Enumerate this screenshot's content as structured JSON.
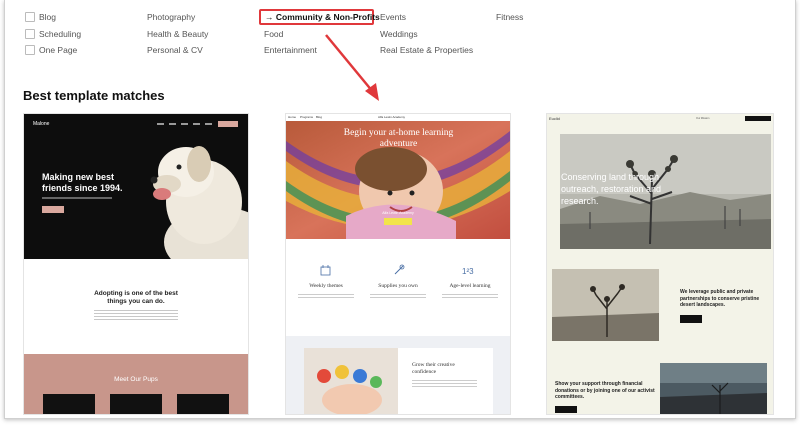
{
  "categories": {
    "col1": [
      "Blog",
      "Scheduling",
      "One Page"
    ],
    "col2": [
      "Photography",
      "Health & Beauty",
      "Personal & CV"
    ],
    "col3_selected": "Community & Non-Profits",
    "col3": [
      "Food",
      "Entertainment"
    ],
    "col4": [
      "Events",
      "Weddings",
      "Real Estate & Properties"
    ],
    "col5": [
      "Fitness"
    ]
  },
  "selected_arrow": "→",
  "section_title": "Best template matches",
  "templates": [
    {
      "brand": "Malone",
      "hero_title": "Making new best friends since 1994.",
      "mid_heading": "Adopting is one of the best things you can do.",
      "bottom_heading": "Meet Our Pups",
      "colors": {
        "hero_bg": "#0d0d0d",
        "button": "#d9a89e",
        "bottom_bg": "#c8968b"
      }
    },
    {
      "brand": "Alfa Lewin Academy",
      "nav": [
        "Home",
        "Programs",
        "Blog"
      ],
      "hero_title": "Begin your at-home learning adventure",
      "hero_sub": "Alfa Lewin Academy",
      "features": [
        "Weekly themes",
        "Supplies you own",
        "Age-level learning"
      ],
      "promo_heading": "Grow their creative confidence",
      "colors": {
        "button": "#f2e44a",
        "promo_bg": "#eef0f4"
      }
    },
    {
      "brand": "Euclid",
      "nav": [
        "Our Mission",
        "Get Involved"
      ],
      "hero_title": "Conserving land through outreach, restoration and research.",
      "mid_text": "We leverage public and private partnerships to conserve pristine desert landscapes.",
      "bottom_text": "Show your support through financial donations or by joining one of our activist committees.",
      "colors": {
        "page_bg": "#f3f3e8"
      }
    }
  ]
}
